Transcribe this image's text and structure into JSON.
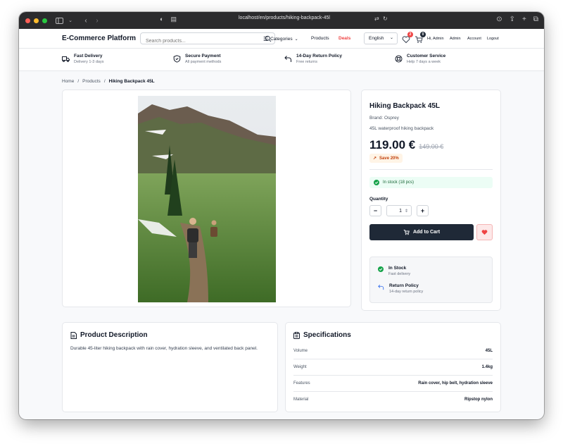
{
  "browser": {
    "url": "localhost/en/products/hiking-backpack-45l",
    "light_colors": [
      "#ff5f57",
      "#febc2e",
      "#28c840"
    ]
  },
  "header": {
    "brand": "E-Commerce Platform",
    "search_placeholder": "Search products...",
    "categories_label": "Categories",
    "products_label": "Products",
    "deals_label": "Deals",
    "deals_color": "#ef4444",
    "language": "English",
    "wishlist_count": "2",
    "cart_count": "0",
    "greeting": "Hi, Admin",
    "admin_label": "Admin",
    "account_label": "Account",
    "logout_label": "Logout"
  },
  "features": [
    {
      "icon": "truck-icon",
      "title": "Fast Delivery",
      "subtitle": "Delivery 1-3 days"
    },
    {
      "icon": "shield-icon",
      "title": "Secure Payment",
      "subtitle": "All payment methods"
    },
    {
      "icon": "return-arrow-icon",
      "title": "14-Day Return Policy",
      "subtitle": "Free returns"
    },
    {
      "icon": "lifebuoy-icon",
      "title": "Customer Service",
      "subtitle": "Help 7 days a week"
    }
  ],
  "breadcrumb": {
    "home": "Home",
    "products": "Products",
    "current": "Hiking Backpack 45L",
    "separator": "/"
  },
  "product": {
    "name": "Hiking Backpack 45L",
    "brand": "Brand: Osprey",
    "short_description": "45L waterproof hiking backpack",
    "price": "119.00 €",
    "old_price": "149.00 €",
    "save_label": "Save 20%",
    "stock_label": "In stock (18 pcs)",
    "quantity_label": "Quantity",
    "quantity_value": "1",
    "minus": "−",
    "plus": "+",
    "add_to_cart": "Add to Cart",
    "info": [
      {
        "icon": "check-circle-icon",
        "title": "In Stock",
        "subtitle": "Fast delivery"
      },
      {
        "icon": "return-arrow-icon",
        "title": "Return Policy",
        "subtitle": "14-day return policy"
      }
    ]
  },
  "description": {
    "title": "Product Description",
    "text": "Durable 45-liter hiking backpack with rain cover, hydration sleeve, and ventilated back panel."
  },
  "specifications": {
    "title": "Specifications",
    "rows": [
      {
        "key": "Volume",
        "value": "45L"
      },
      {
        "key": "Weight",
        "value": "1.4kg"
      },
      {
        "key": "Features",
        "value": "Rain cover, hip belt, hydration sleeve"
      },
      {
        "key": "Material",
        "value": "Ripstop nylon"
      }
    ]
  },
  "colors": {
    "primary_dark": "#1f2937",
    "stock_green": "#16a34a",
    "save_orange": "#c2410c",
    "heart_red": "#ef4444"
  }
}
